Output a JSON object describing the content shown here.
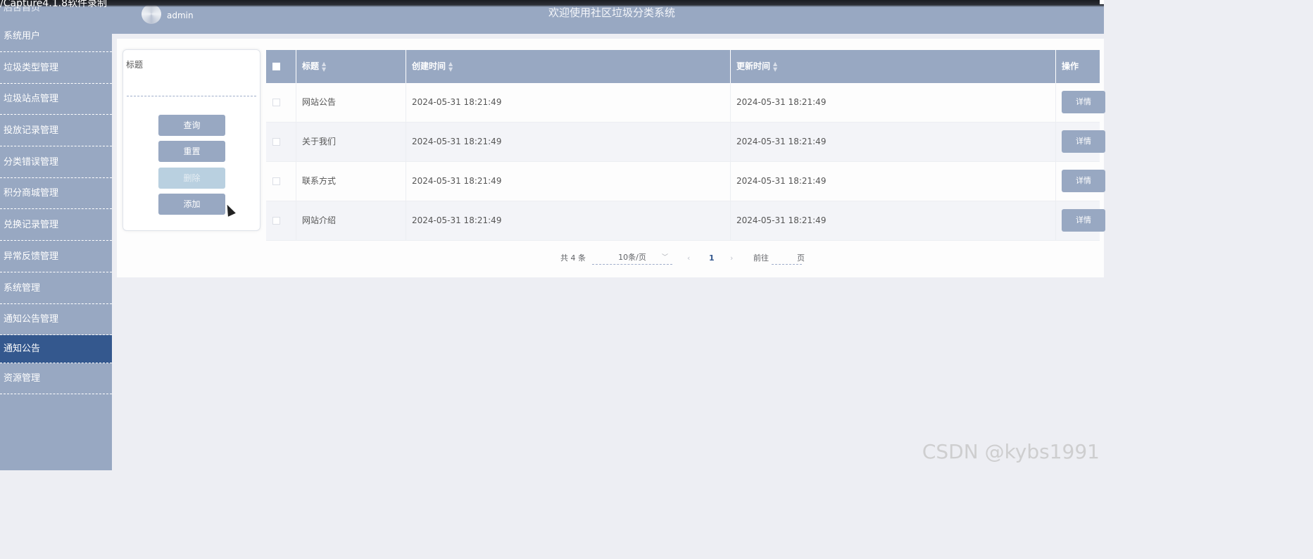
{
  "recorder": {
    "label": "/Capture4.1.8软件录制"
  },
  "header": {
    "username": "admin",
    "system_title": "欢迎使用社区垃圾分类系统"
  },
  "sidebar": {
    "home": "后台首页",
    "items": [
      {
        "label": "系统用户"
      },
      {
        "label": "垃圾类型管理"
      },
      {
        "label": "垃圾站点管理"
      },
      {
        "label": "投放记录管理"
      },
      {
        "label": "分类错误管理"
      },
      {
        "label": "积分商城管理"
      },
      {
        "label": "兑换记录管理"
      },
      {
        "label": "异常反馈管理"
      },
      {
        "label": "系统管理"
      },
      {
        "label": "通知公告管理"
      },
      {
        "label": "通知公告",
        "active": true
      },
      {
        "label": "资源管理"
      }
    ]
  },
  "search": {
    "title_label": "标题",
    "title_value": "",
    "query_label": "查询",
    "reset_label": "重置",
    "delete_label": "删除",
    "add_label": "添加"
  },
  "table": {
    "columns": [
      "标题",
      "创建时间",
      "更新时间",
      "操作"
    ],
    "rows": [
      {
        "title": "网站公告",
        "created": "2024-05-31 18:21:49",
        "updated": "2024-05-31 18:21:49",
        "action": "详情"
      },
      {
        "title": "关于我们",
        "created": "2024-05-31 18:21:49",
        "updated": "2024-05-31 18:21:49",
        "action": "详情"
      },
      {
        "title": "联系方式",
        "created": "2024-05-31 18:21:49",
        "updated": "2024-05-31 18:21:49",
        "action": "详情"
      },
      {
        "title": "网站介绍",
        "created": "2024-05-31 18:21:49",
        "updated": "2024-05-31 18:21:49",
        "action": "详情"
      }
    ]
  },
  "pagination": {
    "total": "共 4 条",
    "page_size": "10条/页",
    "current_page": "1",
    "goto_prefix": "前往",
    "goto_suffix": "页",
    "goto_value": ""
  },
  "watermark": "CSDN @kybs1991",
  "colors": {
    "accent": "#98a8c2",
    "active_nav": "#34588e",
    "disabled": "#b9d0e0"
  }
}
